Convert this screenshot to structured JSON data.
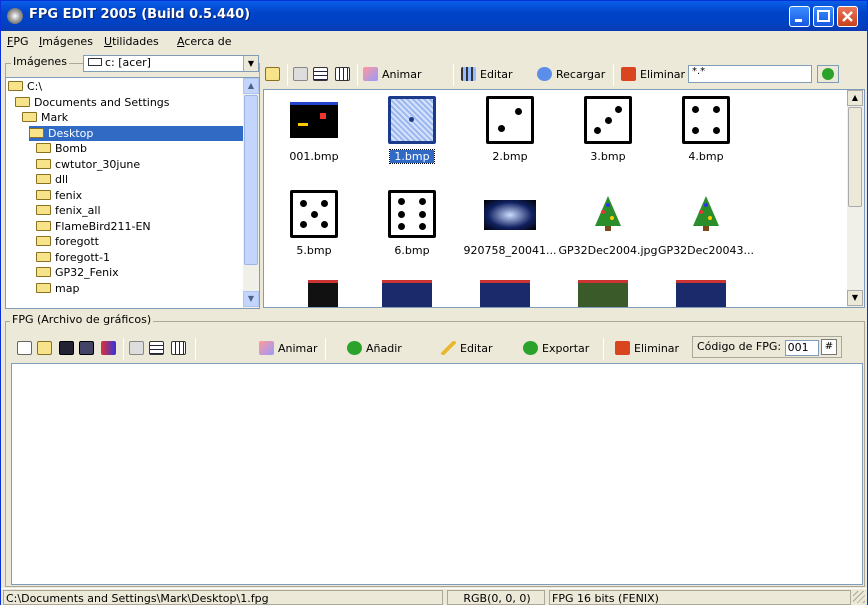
{
  "window": {
    "title": "FPG EDIT 2005 (Build 0.5.440)"
  },
  "menu": [
    "FPG",
    "Imágenes",
    "Utilidades",
    "Acerca de"
  ],
  "images_panel": {
    "legend": "Imágenes",
    "drive": "c: [acer]",
    "tree": [
      {
        "label": "C:\\",
        "level": 0,
        "open": true
      },
      {
        "label": "Documents and Settings",
        "level": 1,
        "open": true
      },
      {
        "label": "Mark",
        "level": 2,
        "open": true
      },
      {
        "label": "Desktop",
        "level": 3,
        "open": true,
        "selected": true
      },
      {
        "label": "Bomb",
        "level": 4
      },
      {
        "label": "cwtutor_30june",
        "level": 4
      },
      {
        "label": "dll",
        "level": 4
      },
      {
        "label": "fenix",
        "level": 4
      },
      {
        "label": "fenix_all",
        "level": 4
      },
      {
        "label": "FlameBird211-EN",
        "level": 4
      },
      {
        "label": "foregott",
        "level": 4
      },
      {
        "label": "foregott-1",
        "level": 4
      },
      {
        "label": "GP32_Fenix",
        "level": 4
      },
      {
        "label": "map",
        "level": 4
      }
    ]
  },
  "toolbar_top": {
    "animar": "Animar",
    "editar": "Editar",
    "recargar": "Recargar",
    "eliminar": "Eliminar",
    "filter": "*.*"
  },
  "thumbnails": [
    {
      "label": "001.bmp",
      "kind": "screen"
    },
    {
      "label": "1.bmp",
      "kind": "die1",
      "selected": true
    },
    {
      "label": "2.bmp",
      "kind": "die2"
    },
    {
      "label": "3.bmp",
      "kind": "die3"
    },
    {
      "label": "4.bmp",
      "kind": "die4"
    },
    {
      "label": "5.bmp",
      "kind": "die5"
    },
    {
      "label": "6.bmp",
      "kind": "die6"
    },
    {
      "label": "920758_20041...",
      "kind": "photo"
    },
    {
      "label": "GP32Dec2004.jpg",
      "kind": "tree"
    },
    {
      "label": "GP32Dec20043...",
      "kind": "tree"
    }
  ],
  "fpg_panel": {
    "legend": "FPG (Archivo de gráficos)",
    "animar": "Animar",
    "anadir": "Añadir",
    "editar": "Editar",
    "exportar": "Exportar",
    "eliminar": "Eliminar",
    "codigo_label": "Código de FPG:",
    "codigo_value": "001"
  },
  "status": {
    "path": "C:\\Documents and Settings\\Mark\\Desktop\\1.fpg",
    "rgb": "RGB(0, 0, 0)",
    "mode": "FPG 16 bits (FENIX)"
  }
}
